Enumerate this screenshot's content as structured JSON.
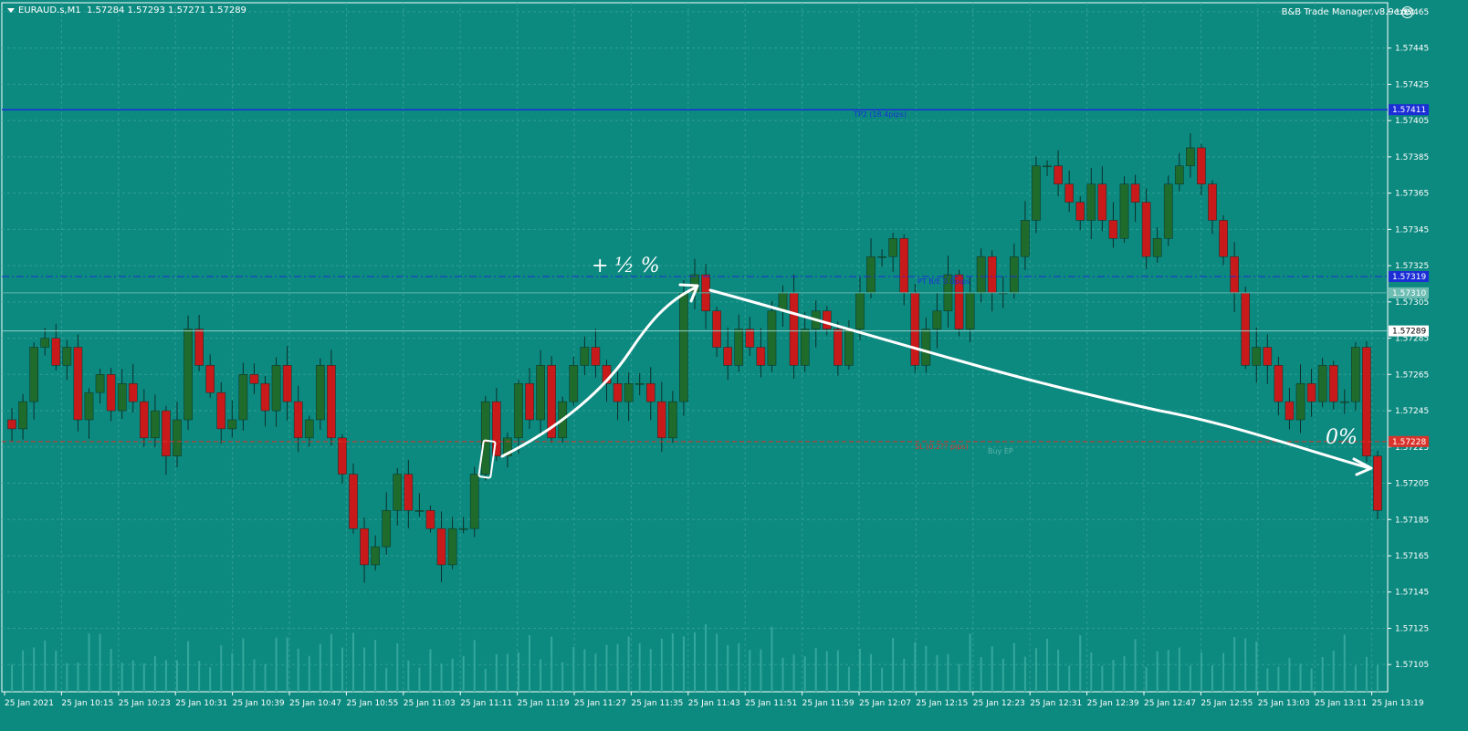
{
  "header": {
    "symbol": "EURAUD.s,M1",
    "ohlc": "1.57284 1.57293 1.57271 1.57289",
    "ea_name": "B&B Trade Manager.v8.9exec",
    "ea_icon": "smiley-icon"
  },
  "colors": {
    "background": "#0d8a80",
    "grid": "#2f9e95",
    "bull": "#1e6b2c",
    "bear": "#c81a1a",
    "wick": "#0c2e2a",
    "volume": "#34a79c",
    "tp_line": "#1c2fd6",
    "be_line": "#1c2fd6",
    "sl_line": "#d9332b",
    "ask_line": "#5fb4aa",
    "bid_line": "#8fcfc7",
    "annotation": "#ffffff"
  },
  "chart_data": {
    "type": "candlestick",
    "symbol": "EURAUD.s",
    "timeframe": "M1",
    "ylim": [
      1.5709,
      1.5747
    ],
    "y_ticks": [
      "1.57465",
      "1.57445",
      "1.57425",
      "1.57405",
      "1.57385",
      "1.57365",
      "1.57345",
      "1.57325",
      "1.57305",
      "1.57285",
      "1.57265",
      "1.57245",
      "1.57225",
      "1.57205",
      "1.57185",
      "1.57165",
      "1.57145",
      "1.57125",
      "1.57105"
    ],
    "x_labels": [
      "25 Jan 2021",
      "25 Jan 10:15",
      "25 Jan 10:23",
      "25 Jan 10:31",
      "25 Jan 10:39",
      "25 Jan 10:47",
      "25 Jan 10:55",
      "25 Jan 11:03",
      "25 Jan 11:11",
      "25 Jan 11:19",
      "25 Jan 11:27",
      "25 Jan 11:35",
      "25 Jan 11:43",
      "25 Jan 11:51",
      "25 Jan 11:59",
      "25 Jan 12:07",
      "25 Jan 12:15",
      "25 Jan 12:23",
      "25 Jan 12:31",
      "25 Jan 12:39",
      "25 Jan 12:47",
      "25 Jan 12:55",
      "25 Jan 13:03",
      "25 Jan 13:11",
      "25 Jan 13:19"
    ],
    "close": [
      1.57235,
      1.5725,
      1.5728,
      1.57285,
      1.5727,
      1.5728,
      1.5724,
      1.57255,
      1.57265,
      1.57245,
      1.5726,
      1.5725,
      1.5723,
      1.57245,
      1.5722,
      1.5724,
      1.5729,
      1.5727,
      1.57255,
      1.57235,
      1.5724,
      1.57265,
      1.5726,
      1.57245,
      1.5727,
      1.5725,
      1.5723,
      1.5724,
      1.5727,
      1.5723,
      1.5721,
      1.5718,
      1.5716,
      1.5717,
      1.5719,
      1.5721,
      1.5719,
      1.5719,
      1.5718,
      1.5716,
      1.5718,
      1.5718,
      1.5721,
      1.5725,
      1.5722,
      1.5723,
      1.5726,
      1.5724,
      1.5727,
      1.5723,
      1.5725,
      1.5727,
      1.5728,
      1.5727,
      1.5726,
      1.5725,
      1.5726,
      1.5726,
      1.5725,
      1.5723,
      1.5725,
      1.5731,
      1.5732,
      1.573,
      1.5728,
      1.5727,
      1.5729,
      1.5728,
      1.5727,
      1.573,
      1.5731,
      1.5727,
      1.5729,
      1.573,
      1.5729,
      1.5727,
      1.5729,
      1.5731,
      1.5733,
      1.5733,
      1.5734,
      1.5731,
      1.5727,
      1.5729,
      1.573,
      1.5732,
      1.5729,
      1.5731,
      1.5733,
      1.5731,
      1.5731,
      1.5733,
      1.5735,
      1.5738,
      1.5738,
      1.5737,
      1.5736,
      1.5735,
      1.5737,
      1.5735,
      1.5734,
      1.5737,
      1.5736,
      1.5733,
      1.5734,
      1.5737,
      1.5738,
      1.5739,
      1.5737,
      1.5735,
      1.5733,
      1.5731,
      1.5727,
      1.5728,
      1.5727,
      1.5725,
      1.5724,
      1.5726,
      1.5725,
      1.5727,
      1.5725,
      1.5725,
      1.5728,
      1.5722,
      1.5719
    ],
    "levels": [
      {
        "name": "TP2",
        "price": 1.57411,
        "label": "TP2 (18.4pips)",
        "price_label": "1.57411"
      },
      {
        "name": "BE",
        "price": 1.57319,
        "label": "PT B/E 0.0pips",
        "price_label": "1.57319"
      },
      {
        "name": "Ask",
        "price": 1.5731,
        "price_label": "1.57310"
      },
      {
        "name": "Bid",
        "price": 1.57289,
        "price_label": "1.57289"
      },
      {
        "name": "SL",
        "price": 1.57228,
        "label": "SL (0.2?? pips)",
        "price_label": "1.57228"
      }
    ],
    "order_label": "Buy EP"
  },
  "annotations": {
    "gain_text": "+ ½ %",
    "zero_text": "0%"
  }
}
